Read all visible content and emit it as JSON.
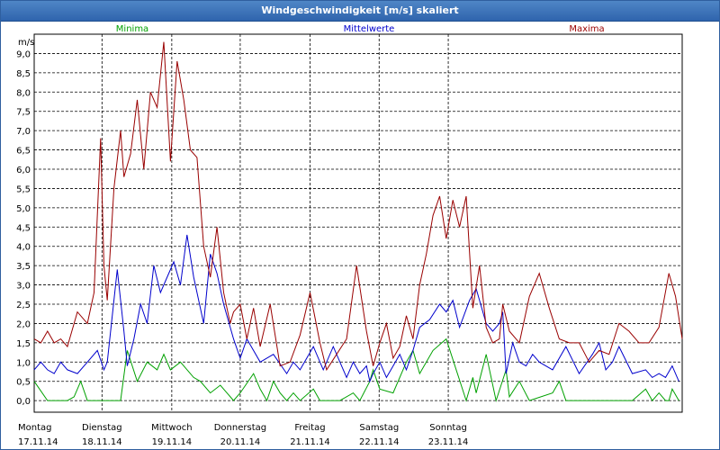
{
  "window": {
    "title": "Windgeschwindigkeit [m/s] skaliert"
  },
  "chart_data": {
    "type": "line",
    "title": "Windgeschwindigkeit [m/s] skaliert",
    "ylabel": "m/s",
    "ylim": [
      -0.3,
      9.5
    ],
    "yticks": [
      "0,0",
      "0,5",
      "1,0",
      "1,5",
      "2,0",
      "2,5",
      "3,0",
      "3,5",
      "4,0",
      "4,5",
      "5,0",
      "5,5",
      "6,0",
      "6,5",
      "7,0",
      "7,5",
      "8,0",
      "8,5",
      "9,0"
    ],
    "x_labels": [
      {
        "day": "Montag",
        "date": "17.11.14"
      },
      {
        "day": "Dienstag",
        "date": "18.11.14"
      },
      {
        "day": "Mittwoch",
        "date": "19.11.14"
      },
      {
        "day": "Donnerstag",
        "date": "20.11.14"
      },
      {
        "day": "Freitag",
        "date": "21.11.14"
      },
      {
        "day": "Samstag",
        "date": "22.11.14"
      },
      {
        "day": "Sonntag",
        "date": "23.11.14"
      }
    ],
    "x_unit": "days since 17.11.14 00:00",
    "grid": true,
    "legend_position": "top",
    "series": [
      {
        "name": "Minima",
        "color": "#00a000",
        "x": [
          0,
          0.2,
          0.3,
          0.5,
          0.6,
          0.7,
          0.8,
          1.0,
          1.3,
          1.4,
          1.55,
          1.7,
          1.85,
          1.95,
          2.05,
          2.2,
          2.4,
          2.5,
          2.65,
          2.8,
          3.0,
          3.1,
          3.3,
          3.4,
          3.5,
          3.6,
          3.7,
          3.8,
          3.9,
          4.0,
          4.2,
          4.3,
          4.5,
          4.6,
          4.8,
          4.9,
          5.05,
          5.1,
          5.2,
          5.4,
          5.6,
          5.7,
          5.8,
          6.0,
          6.2,
          6.5,
          6.6,
          6.65,
          6.8,
          6.95,
          7.1,
          7.15,
          7.3,
          7.45,
          7.8,
          7.9,
          8.0,
          8.1,
          8.2,
          8.3,
          8.5,
          8.7,
          9.0,
          9.2,
          9.3,
          9.4,
          9.5,
          9.55,
          9.6,
          9.7
        ],
        "y": [
          0.5,
          0,
          0,
          0,
          0.1,
          0.5,
          0,
          0,
          0,
          1.3,
          0.5,
          1.0,
          0.8,
          1.2,
          0.8,
          1.0,
          0.6,
          0.5,
          0.2,
          0.4,
          0,
          0.2,
          0.7,
          0.3,
          0,
          0.5,
          0.2,
          0,
          0.2,
          0,
          0.3,
          0,
          0,
          0,
          0.2,
          0,
          0.5,
          0.8,
          0.3,
          0.2,
          1.0,
          1.3,
          0.7,
          1.3,
          1.6,
          0,
          0.6,
          0.2,
          1.2,
          0,
          0.8,
          0.1,
          0.5,
          0,
          0.2,
          0.5,
          0,
          0,
          0,
          0,
          0,
          0,
          0,
          0.3,
          0,
          0.2,
          0,
          0,
          0.3,
          0
        ]
      },
      {
        "name": "Mittelwerte",
        "color": "#0000cc",
        "x": [
          0,
          0.1,
          0.2,
          0.3,
          0.4,
          0.5,
          0.65,
          0.8,
          0.95,
          1.05,
          1.1,
          1.25,
          1.35,
          1.4,
          1.5,
          1.6,
          1.7,
          1.8,
          1.9,
          2.0,
          2.1,
          2.2,
          2.3,
          2.4,
          2.55,
          2.65,
          2.75,
          2.85,
          3.0,
          3.1,
          3.2,
          3.4,
          3.6,
          3.8,
          3.9,
          4.0,
          4.2,
          4.35,
          4.5,
          4.7,
          4.8,
          4.9,
          5.0,
          5.05,
          5.1,
          5.2,
          5.3,
          5.4,
          5.5,
          5.6,
          5.7,
          5.8,
          5.95,
          6.1,
          6.2,
          6.3,
          6.4,
          6.55,
          6.65,
          6.8,
          6.9,
          7.0,
          7.05,
          7.1,
          7.2,
          7.3,
          7.4,
          7.5,
          7.6,
          7.8,
          8.0,
          8.2,
          8.4,
          8.5,
          8.6,
          8.7,
          8.8,
          9.0,
          9.2,
          9.3,
          9.4,
          9.5,
          9.6,
          9.7
        ],
        "y": [
          0.8,
          1.0,
          0.8,
          0.7,
          1.0,
          0.8,
          0.7,
          1.0,
          1.3,
          0.8,
          1.0,
          3.4,
          1.8,
          0.9,
          1.6,
          2.5,
          2.0,
          3.5,
          2.8,
          3.2,
          3.6,
          3.0,
          4.3,
          3.2,
          2.0,
          3.8,
          3.3,
          2.5,
          1.6,
          1.1,
          1.6,
          1.0,
          1.2,
          0.7,
          1.0,
          0.8,
          1.4,
          0.8,
          1.4,
          0.6,
          1.0,
          0.7,
          0.9,
          0.5,
          0.7,
          1.0,
          0.6,
          0.9,
          1.2,
          0.8,
          1.3,
          1.9,
          2.1,
          2.5,
          2.3,
          2.6,
          1.9,
          2.6,
          2.9,
          2.0,
          1.8,
          2.0,
          2.3,
          0.7,
          1.5,
          1.0,
          0.9,
          1.2,
          1.0,
          0.8,
          1.4,
          0.7,
          1.2,
          1.5,
          0.8,
          1.0,
          1.4,
          0.7,
          0.8,
          0.6,
          0.7,
          0.6,
          0.9,
          0.5
        ]
      },
      {
        "name": "Maxima",
        "color": "#990000",
        "x": [
          0,
          0.1,
          0.2,
          0.3,
          0.4,
          0.5,
          0.65,
          0.8,
          0.9,
          1.0,
          1.05,
          1.1,
          1.2,
          1.3,
          1.35,
          1.45,
          1.55,
          1.65,
          1.75,
          1.85,
          1.95,
          2.05,
          2.15,
          2.25,
          2.35,
          2.45,
          2.55,
          2.65,
          2.75,
          2.85,
          2.95,
          3.0,
          3.1,
          3.2,
          3.3,
          3.4,
          3.55,
          3.7,
          3.85,
          4.0,
          4.15,
          4.3,
          4.4,
          4.55,
          4.7,
          4.85,
          5.0,
          5.1,
          5.2,
          5.3,
          5.4,
          5.5,
          5.6,
          5.7,
          5.8,
          5.9,
          6.0,
          6.1,
          6.2,
          6.3,
          6.4,
          6.5,
          6.6,
          6.7,
          6.8,
          6.9,
          7.0,
          7.05,
          7.15,
          7.3,
          7.45,
          7.6,
          7.75,
          7.9,
          8.05,
          8.2,
          8.35,
          8.5,
          8.65,
          8.8,
          8.95,
          9.1,
          9.25,
          9.4,
          9.55,
          9.65,
          9.75
        ],
        "y": [
          1.6,
          1.5,
          1.8,
          1.5,
          1.6,
          1.4,
          2.3,
          2.0,
          2.8,
          6.8,
          3.5,
          2.6,
          5.5,
          7.0,
          5.8,
          6.4,
          7.8,
          6.0,
          8.0,
          7.6,
          9.3,
          6.2,
          8.8,
          7.8,
          6.5,
          6.3,
          4.0,
          3.2,
          4.5,
          2.8,
          2.0,
          2.3,
          2.5,
          1.6,
          2.4,
          1.4,
          2.5,
          0.9,
          1.0,
          1.7,
          2.8,
          1.5,
          0.8,
          1.2,
          1.6,
          3.5,
          1.8,
          0.9,
          1.5,
          2.0,
          1.1,
          1.4,
          2.2,
          1.6,
          3.0,
          3.8,
          4.8,
          5.3,
          4.2,
          5.2,
          4.5,
          5.3,
          2.4,
          3.5,
          1.9,
          1.5,
          1.6,
          2.5,
          1.8,
          1.5,
          2.7,
          3.3,
          2.4,
          1.6,
          1.5,
          1.5,
          1.0,
          1.3,
          1.2,
          2.0,
          1.8,
          1.5,
          1.5,
          1.9,
          3.3,
          2.7,
          1.6
        ]
      }
    ]
  }
}
